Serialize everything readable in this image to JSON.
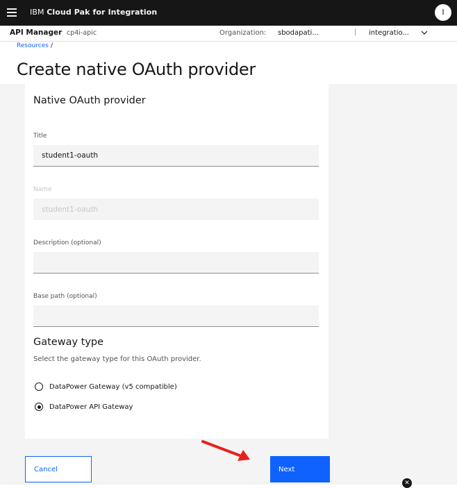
{
  "header": {
    "brand": "IBM",
    "product": "Cloud Pak for Integration",
    "user_initial": "I"
  },
  "subheader": {
    "app_name": "API Manager",
    "cluster": "cp4i-apic",
    "org_label": "Organization:",
    "org_value": "sbodapati...",
    "separator": "|",
    "catalog_value": "integratio..."
  },
  "breadcrumb": {
    "link": "Resources",
    "separator": "/"
  },
  "page_title": "Create native OAuth provider",
  "form": {
    "section_title": "Native OAuth provider",
    "title_label": "Title",
    "title_value": "student1-oauth",
    "name_label": "Name",
    "name_value": "student1-oauth",
    "description_label": "Description (optional)",
    "description_value": "",
    "base_path_label": "Base path (optional)",
    "base_path_value": ""
  },
  "gateway": {
    "section_title": "Gateway type",
    "helper": "Select the gateway type for this OAuth provider.",
    "options": [
      {
        "label": "DataPower Gateway (v5 compatible)",
        "selected": false
      },
      {
        "label": "DataPower API Gateway",
        "selected": true
      }
    ]
  },
  "actions": {
    "cancel_label": "Cancel",
    "next_label": "Next"
  },
  "colors": {
    "primary": "#0f62fe",
    "header_bg": "#161616",
    "annotation_arrow": "#e8201c"
  }
}
